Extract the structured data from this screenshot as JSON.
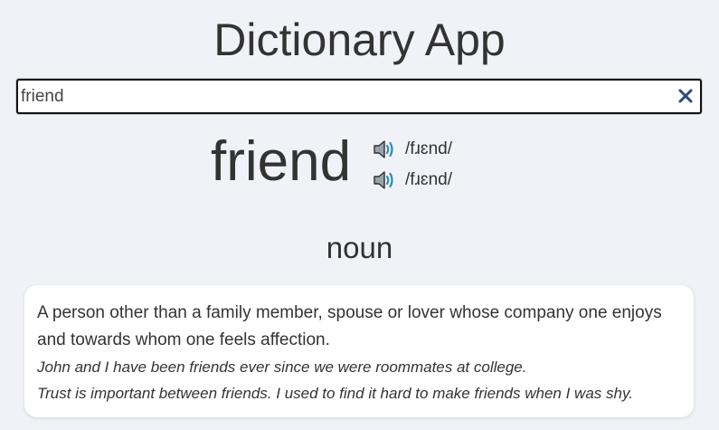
{
  "app": {
    "title": "Dictionary App"
  },
  "search": {
    "value": "friend",
    "clear_icon": "close-x"
  },
  "entry": {
    "word": "friend",
    "pronunciations": [
      {
        "ipa": "/fɹɛnd/",
        "icon": "speaker-icon"
      },
      {
        "ipa": "/fɹɛnd/",
        "icon": "speaker-icon"
      }
    ],
    "part_of_speech": "noun",
    "definition": "A person other than a family member, spouse or lover whose company one enjoys and towards whom one feels affection.",
    "examples": [
      "John and I have been friends ever since we were roommates at college.",
      "Trust is important between friends.",
      "I used to find it hard to make friends when I was shy."
    ]
  },
  "colors": {
    "background": "#f1f2f7",
    "clear_icon": "#2c4a7c",
    "speaker_wave": "#2a8fb8"
  }
}
